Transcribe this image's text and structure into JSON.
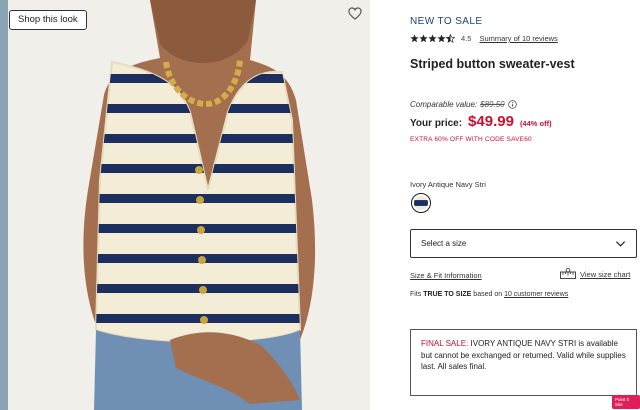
{
  "image_panel": {
    "shop_label": "Shop this look",
    "photo": "model-in-striped-vest"
  },
  "product": {
    "eyebrow": "NEW TO SALE",
    "rating": 4.5,
    "rating_text": "4.5",
    "review_link": "Summary of 10 reviews",
    "title": "Striped button sweater-vest",
    "comparable_label": "Comparable value:",
    "comparable_price": "$89.50",
    "price_label": "Your price:",
    "price": "$49.99",
    "price_off": "(44% off)",
    "promo": "EXTRA 60% OFF WITH CODE SAVE60",
    "color_name": "Ivory Antique Navy Stri",
    "size_placeholder": "Select a size",
    "fit_link": "Size & Fit Information",
    "size_chart": "View size chart",
    "fits": {
      "prefix": "Fits",
      "bold": "TRUE TO SIZE",
      "middle": "based on",
      "link": "10 customer reviews"
    },
    "final_sale": {
      "label": "FINAL SALE:",
      "text": " IVORY ANTIQUE NAVY STRI is available but cannot be exchanged or returned. Valid while supplies last. All sales final."
    }
  },
  "feedback_label": "Point It Site",
  "colors": {
    "price_red": "#c8102e",
    "eyebrow_blue": "#1f4178",
    "navy_stripe": "#1d2f5e",
    "ivory": "#f3ecd7"
  },
  "icons": [
    "heart-icon",
    "star-icon",
    "info-icon",
    "chevron-down-icon",
    "ruler-icon"
  ]
}
